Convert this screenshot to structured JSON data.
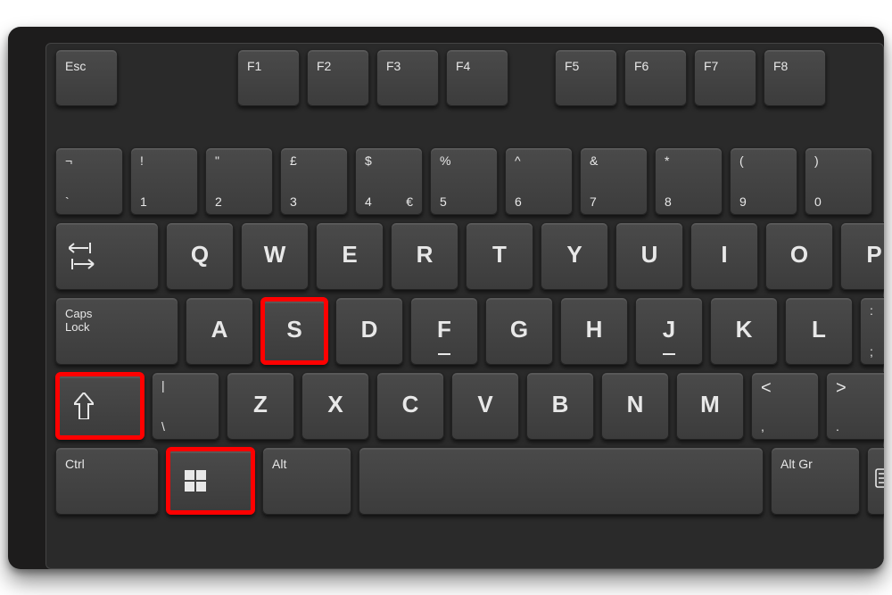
{
  "keyboard": {
    "function_row": {
      "esc": "Esc",
      "f1": "F1",
      "f2": "F2",
      "f3": "F3",
      "f4": "F4",
      "f5": "F5",
      "f6": "F6",
      "f7": "F7",
      "f8": "F8"
    },
    "number_row": {
      "backtick": {
        "top": "¬",
        "bottom": "`"
      },
      "k1": {
        "top": "!",
        "bottom": "1"
      },
      "k2": {
        "top": "\"",
        "bottom": "2"
      },
      "k3": {
        "top": "£",
        "bottom": "3"
      },
      "k4": {
        "top": "$",
        "bottom": "4",
        "right": "€"
      },
      "k5": {
        "top": "%",
        "bottom": "5"
      },
      "k6": {
        "top": "^",
        "bottom": "6"
      },
      "k7": {
        "top": "&",
        "bottom": "7"
      },
      "k8": {
        "top": "*",
        "bottom": "8"
      },
      "k9": {
        "top": "(",
        "bottom": "9"
      },
      "k0": {
        "top": ")",
        "bottom": "0"
      }
    },
    "qwerty_row": {
      "tab": "Tab",
      "q": "Q",
      "w": "W",
      "e": "E",
      "r": "R",
      "t": "T",
      "y": "Y",
      "u": "U",
      "i": "I",
      "o": "O",
      "p": "P"
    },
    "home_row": {
      "caps": "Caps\nLock",
      "a": "A",
      "s": "S",
      "d": "D",
      "f": "F",
      "g": "G",
      "h": "H",
      "j": "J",
      "k": "K",
      "l": "L",
      "semi": {
        "top": ":",
        "bottom": ";"
      }
    },
    "shift_row": {
      "shift": "Shift",
      "bslash": {
        "top": "|",
        "bottom": "\\"
      },
      "z": "Z",
      "x": "X",
      "c": "C",
      "v": "V",
      "b": "B",
      "n": "N",
      "m": "M",
      "comma": {
        "top": "<",
        "bottom": ","
      },
      "period": {
        "top": ">",
        "bottom": "."
      }
    },
    "bottom_row": {
      "ctrl": "Ctrl",
      "win": "Windows",
      "alt": "Alt",
      "space": " ",
      "altgr": "Alt Gr",
      "menu": "Menu"
    }
  },
  "highlighted_keys": [
    "shift",
    "win",
    "s"
  ],
  "shortcut_description": "Windows + Shift + S"
}
